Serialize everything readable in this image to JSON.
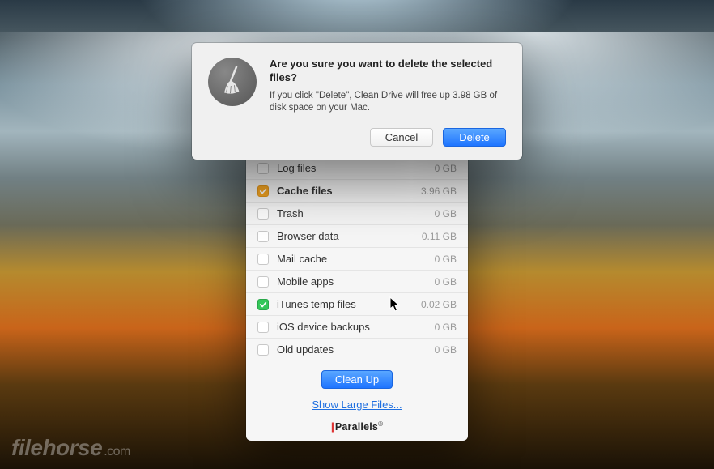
{
  "dialog": {
    "title": "Are you sure you want to delete the selected files?",
    "message": "If you click \"Delete\", Clean Drive will free up 3.98 GB of disk space on your Mac.",
    "cancel_label": "Cancel",
    "delete_label": "Delete",
    "icon": "broom-icon"
  },
  "panel": {
    "items": [
      {
        "label": "Log files",
        "size": "0 GB",
        "checked": false,
        "style": "off",
        "bold": false
      },
      {
        "label": "Cache files",
        "size": "3.96 GB",
        "checked": true,
        "style": "orange",
        "bold": true
      },
      {
        "label": "Trash",
        "size": "0 GB",
        "checked": false,
        "style": "off",
        "bold": false
      },
      {
        "label": "Browser data",
        "size": "0.11 GB",
        "checked": false,
        "style": "off",
        "bold": false
      },
      {
        "label": "Mail cache",
        "size": "0 GB",
        "checked": false,
        "style": "off",
        "bold": false
      },
      {
        "label": "Mobile apps",
        "size": "0 GB",
        "checked": false,
        "style": "off",
        "bold": false
      },
      {
        "label": "iTunes temp files",
        "size": "0.02 GB",
        "checked": true,
        "style": "green",
        "bold": false
      },
      {
        "label": "iOS device backups",
        "size": "0 GB",
        "checked": false,
        "style": "off",
        "bold": false
      },
      {
        "label": "Old updates",
        "size": "0 GB",
        "checked": false,
        "style": "off",
        "bold": false
      }
    ],
    "cleanup_label": "Clean Up",
    "show_large_label": "Show Large Files...",
    "brand": "Parallels"
  },
  "watermark": {
    "name": "filehorse",
    "suffix": ".com"
  }
}
